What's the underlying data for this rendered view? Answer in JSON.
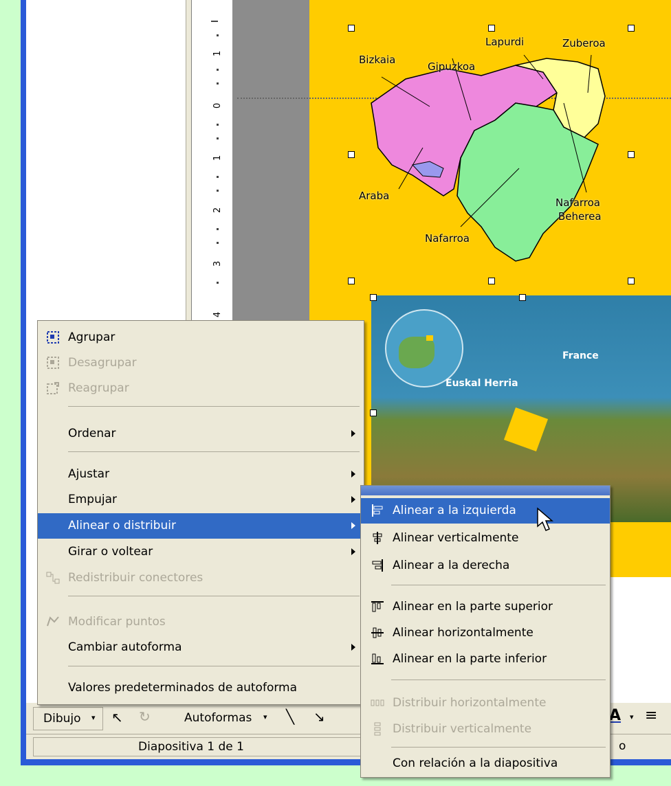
{
  "ruler": {
    "labels": [
      "1",
      "0",
      "1",
      "2",
      "3",
      "4"
    ]
  },
  "map": {
    "labels": {
      "bizkaia": "Bizkaia",
      "gipuzkoa": "Gipuzkoa",
      "lapurdi": "Lapurdi",
      "zuberoa": "Zuberoa",
      "araba": "Araba",
      "nafarroa": "Nafarroa",
      "nafarroa_beherea_1": "Nafarroa",
      "nafarroa_beherea_2": "Beherea"
    }
  },
  "satellite": {
    "france": "France",
    "euskal_herria": "Euskal Herria"
  },
  "context_menu": {
    "items": [
      {
        "label": "Agrupar",
        "icon": "group-icon",
        "disabled": false
      },
      {
        "label": "Desagrupar",
        "icon": "ungroup-icon",
        "disabled": true
      },
      {
        "label": "Reagrupar",
        "icon": "regroup-icon",
        "disabled": true
      },
      {
        "label": "Ordenar",
        "submenu": true
      },
      {
        "label": "Ajustar",
        "submenu": true
      },
      {
        "label": "Empujar",
        "submenu": true
      },
      {
        "label": "Alinear o distribuir",
        "submenu": true,
        "highlighted": true
      },
      {
        "label": "Girar o voltear",
        "submenu": true
      },
      {
        "label": "Redistribuir conectores",
        "icon": "reroute-connectors-icon",
        "disabled": true
      },
      {
        "label": "Modificar puntos",
        "icon": "edit-points-icon",
        "disabled": true
      },
      {
        "label": "Cambiar autoforma",
        "submenu": true
      },
      {
        "label": "Valores predeterminados de autoforma"
      }
    ]
  },
  "submenu": {
    "items": [
      {
        "label": "Alinear a la izquierda",
        "icon": "align-left-icon",
        "highlighted": true
      },
      {
        "label": "Alinear verticalmente",
        "icon": "align-center-icon"
      },
      {
        "label": "Alinear a la derecha",
        "icon": "align-right-icon"
      },
      {
        "label": "Alinear en la parte superior",
        "icon": "align-top-icon"
      },
      {
        "label": "Alinear horizontalmente",
        "icon": "align-middle-icon"
      },
      {
        "label": "Alinear en la parte inferior",
        "icon": "align-bottom-icon"
      },
      {
        "label": "Distribuir horizontalmente",
        "icon": "distribute-horizontal-icon",
        "disabled": true
      },
      {
        "label": "Distribuir verticalmente",
        "icon": "distribute-vertical-icon",
        "disabled": true
      },
      {
        "label": "Con relación a la diapositiva"
      }
    ]
  },
  "drawing_toolbar": {
    "dibujo": "Dibujo",
    "autoformas": "Autoformas"
  },
  "status_bar": {
    "slide_info": "Diapositiva 1 de 1",
    "trailing": "o"
  },
  "colors": {
    "menu_bg": "#ece9d8",
    "highlight": "#316ac5",
    "slide_bg": "#ffcc00",
    "frame_blue": "#2a5ad7"
  }
}
